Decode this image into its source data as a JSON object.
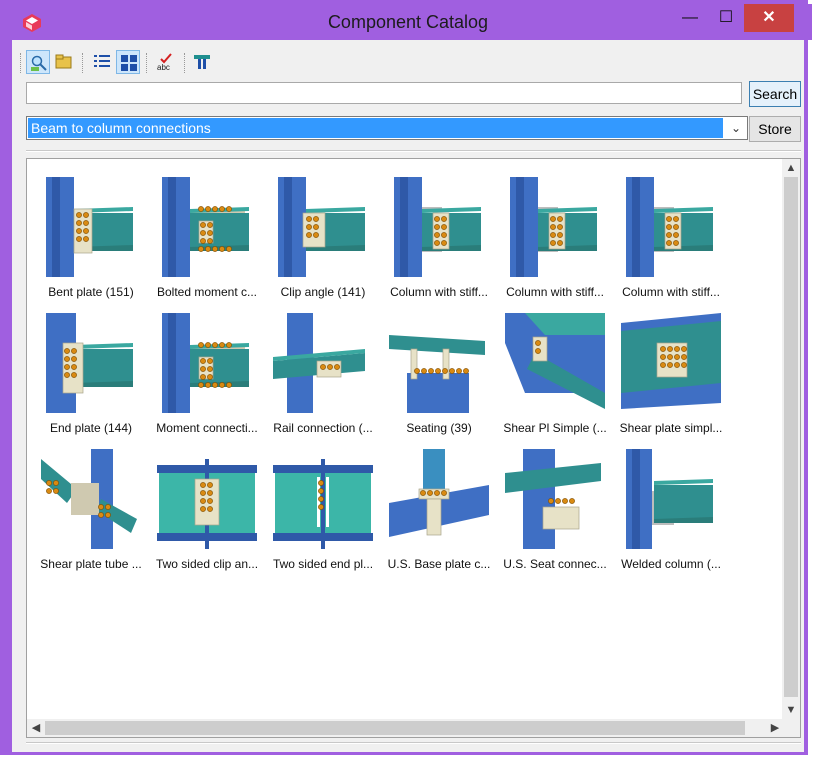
{
  "window": {
    "title": "Component Catalog",
    "minimize": "—",
    "maximize": "☐",
    "close": "✕"
  },
  "toolbar": {
    "buttons": [
      {
        "name": "find-icon",
        "active": true
      },
      {
        "name": "folder-icon",
        "active": false
      },
      {
        "name": "list-view-icon",
        "active": false
      },
      {
        "name": "thumbnail-view-icon",
        "active": true
      },
      {
        "name": "spellcheck-icon",
        "active": false
      },
      {
        "name": "filter-icon",
        "active": false
      }
    ],
    "spellcheck_text": "abc"
  },
  "search": {
    "value": "",
    "button_label": "Search"
  },
  "group": {
    "selected": "Beam to column connections",
    "store_label": "Store"
  },
  "items": [
    {
      "label": "Bent plate (151)",
      "kind": "plate"
    },
    {
      "label": "Bolted moment c...",
      "kind": "moment"
    },
    {
      "label": "Clip angle (141)",
      "kind": "clip"
    },
    {
      "label": "Column with stiff...",
      "kind": "stiff"
    },
    {
      "label": "Column with stiff...",
      "kind": "stiff"
    },
    {
      "label": "Column with stiff...",
      "kind": "stiff"
    },
    {
      "label": "End plate (144)",
      "kind": "endplate"
    },
    {
      "label": "Moment connecti...",
      "kind": "moment"
    },
    {
      "label": "Rail connection (...",
      "kind": "rail"
    },
    {
      "label": "Seating (39)",
      "kind": "seating"
    },
    {
      "label": "Shear Pl Simple (...",
      "kind": "shearpl"
    },
    {
      "label": "Shear plate simpl...",
      "kind": "shearpl2"
    },
    {
      "label": "Shear plate tube ...",
      "kind": "tube"
    },
    {
      "label": "Two sided clip an...",
      "kind": "twoclip"
    },
    {
      "label": "Two sided end pl...",
      "kind": "twoend"
    },
    {
      "label": "U.S. Base plate c...",
      "kind": "base"
    },
    {
      "label": "U.S. Seat connec...",
      "kind": "seat"
    },
    {
      "label": "Welded column (...",
      "kind": "welded"
    }
  ],
  "colors": {
    "accent": "#a05fe0",
    "close": "#c84141",
    "selection": "#3399ff",
    "column": "#3f6fc4",
    "beam": "#2f8f8f"
  }
}
